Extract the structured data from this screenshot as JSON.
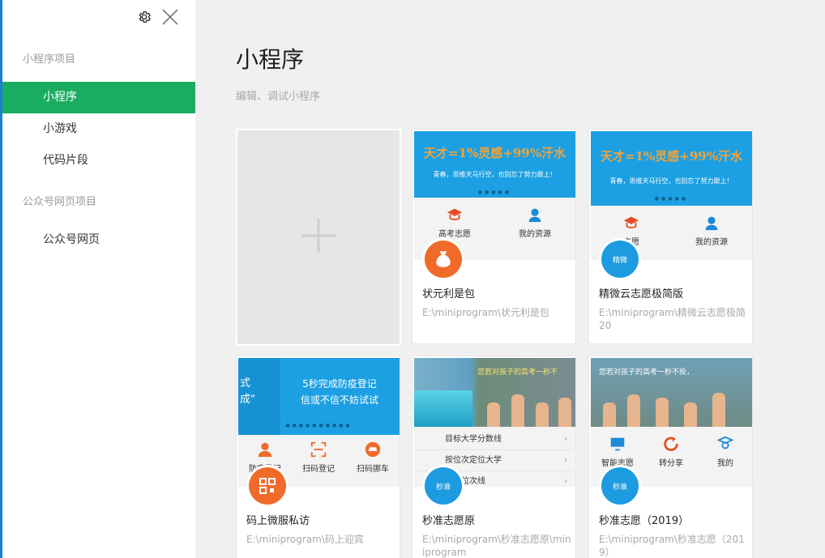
{
  "sidebar": {
    "section1_label": "小程序项目",
    "items": [
      {
        "label": "小程序"
      },
      {
        "label": "小游戏"
      },
      {
        "label": "代码片段"
      }
    ],
    "section2_label": "公众号网页项目",
    "items2": [
      {
        "label": "公众号网页"
      }
    ]
  },
  "main": {
    "title": "小程序",
    "subtitle": "编辑、调试小程序",
    "projects": [
      {
        "name": "状元利是包",
        "path": "E:\\miniprogram\\状元利是包",
        "banner_title": "天才=1%灵感+99%汗水",
        "banner_sub": "青春，思维天马行空，也别忘了努力跟上！",
        "q1": "高考志愿",
        "q2": "我的资源"
      },
      {
        "name": "精微云志愿极简版",
        "path": "E:\\miniprogram\\精微云志愿极简20",
        "banner_title": "天才=1%灵感+99%汗水",
        "banner_sub": "青春，思维天马行空，也别忘了努力跟上！",
        "q1": "志愿",
        "q2": "我的资源",
        "avatar_text": "精微"
      },
      {
        "name": "码上微服私访",
        "path": "E:\\miniprogram\\码上迎宾",
        "banner_left": "式\n成\"",
        "banner_right": "5秒完成防疫登记\n信或不信不妨试试",
        "q1": "防疫登记",
        "q2": "扫码登记",
        "q3": "扫码挪车"
      },
      {
        "name": "秒准志愿原",
        "path": "E:\\miniprogram\\秒准志愿原\\miniprogram",
        "rows": [
          "目标大学分数线",
          "按位次定位大学",
          "分数位次线"
        ],
        "avatar_text": "秒准",
        "photo_text": "您若对孩子的高考一秒不"
      },
      {
        "name": "秒准志愿（2019）",
        "path": "E:\\miniprogram\\秒准志愿（2019）",
        "q1": "智能志愿",
        "q2": "转分享",
        "q3": "我的",
        "avatar_text": "秒准",
        "photo_text": "您若对孩子的高考一秒不投，"
      }
    ]
  },
  "colors": {
    "accent": "#1aad5f",
    "banner": "#1ca0e3",
    "edge": "#1b7fd8"
  }
}
